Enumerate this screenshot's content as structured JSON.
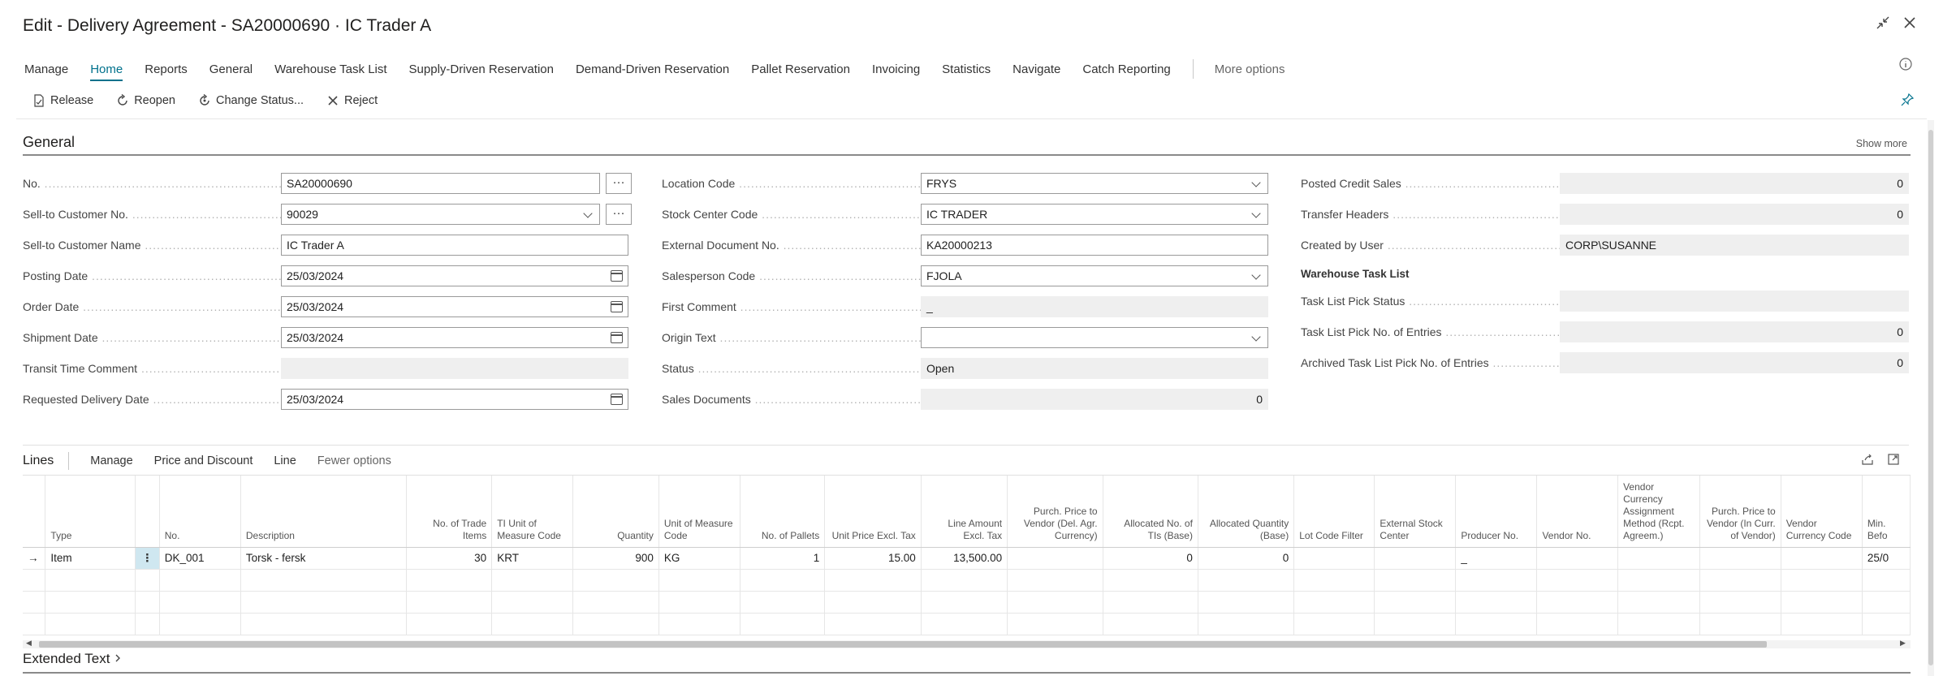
{
  "window": {
    "title": "Edit - Delivery Agreement - SA20000690 · IC Trader A",
    "collapse_icon": "collapse-icon",
    "close_icon": "close-icon",
    "info_icon": "info-icon",
    "pin_icon": "pin-icon"
  },
  "tabs": [
    {
      "label": "Manage"
    },
    {
      "label": "Home",
      "active": true
    },
    {
      "label": "Reports"
    },
    {
      "label": "General"
    },
    {
      "label": "Warehouse Task List"
    },
    {
      "label": "Supply-Driven Reservation"
    },
    {
      "label": "Demand-Driven Reservation"
    },
    {
      "label": "Pallet Reservation"
    },
    {
      "label": "Invoicing"
    },
    {
      "label": "Statistics"
    },
    {
      "label": "Navigate"
    },
    {
      "label": "Catch Reporting"
    }
  ],
  "tabs_more": "More options",
  "actions": [
    {
      "label": "Release",
      "icon": "release-icon"
    },
    {
      "label": "Reopen",
      "icon": "reopen-icon"
    },
    {
      "label": "Change Status...",
      "icon": "change-status-icon"
    },
    {
      "label": "Reject",
      "icon": "reject-icon"
    }
  ],
  "general": {
    "title": "General",
    "show_more": "Show more",
    "col1": [
      {
        "label": "No.",
        "value": "SA20000690"
      },
      {
        "label": "Sell-to Customer No.",
        "value": "90029"
      },
      {
        "label": "Sell-to Customer Name",
        "value": "IC Trader A"
      },
      {
        "label": "Posting Date",
        "value": "25/03/2024"
      },
      {
        "label": "Order Date",
        "value": "25/03/2024"
      },
      {
        "label": "Shipment Date",
        "value": "25/03/2024"
      },
      {
        "label": "Transit Time Comment",
        "value": ""
      },
      {
        "label": "Requested Delivery Date",
        "value": "25/03/2024"
      }
    ],
    "col2": [
      {
        "label": "Location Code",
        "value": "FRYS"
      },
      {
        "label": "Stock Center Code",
        "value": "IC TRADER"
      },
      {
        "label": "External Document No.",
        "value": "KA20000213"
      },
      {
        "label": "Salesperson Code",
        "value": "FJOLA"
      },
      {
        "label": "First Comment",
        "value": "_"
      },
      {
        "label": "Origin Text",
        "value": ""
      },
      {
        "label": "Status",
        "value": "Open"
      },
      {
        "label": "Sales Documents",
        "value": "0"
      }
    ],
    "col3": [
      {
        "label": "Posted Credit Sales",
        "value": "0"
      },
      {
        "label": "Transfer Headers",
        "value": "0"
      },
      {
        "label": "Created by User",
        "value": "CORP\\SUSANNE"
      }
    ],
    "warehouse_header": "Warehouse Task List",
    "col3b": [
      {
        "label": "Task List Pick Status",
        "value": ""
      },
      {
        "label": "Task List Pick No. of Entries",
        "value": "0"
      },
      {
        "label": "Archived Task List Pick No. of Entries",
        "value": "0"
      }
    ]
  },
  "lines": {
    "title": "Lines",
    "menu": [
      "Manage",
      "Price and Discount",
      "Line"
    ],
    "fewer": "Fewer options",
    "share_icon": "share-icon",
    "expand_icon": "expand-icon",
    "headers": [
      "Type",
      "No.",
      "Description",
      "No. of Trade Items",
      "TI Unit of Measure Code",
      "Quantity",
      "Unit of Measure Code",
      "No. of Pallets",
      "Unit Price Excl. Tax",
      "Line Amount Excl. Tax",
      "Purch. Price to Vendor (Del. Agr. Currency)",
      "Allocated No. of TIs (Base)",
      "Allocated Quantity (Base)",
      "Lot Code Filter",
      "External Stock Center",
      "Producer No.",
      "Vendor No.",
      "Vendor Currency Assignment Method (Rcpt. Agreem.)",
      "Purch. Price to Vendor (In Curr. of Vendor)",
      "Vendor Currency Code",
      "Min. Befo"
    ],
    "row": {
      "arrow": "→",
      "dots": "⋮",
      "type": "Item",
      "no": "DK_001",
      "description": "Torsk - fersk",
      "trade_items": "30",
      "ti_uom": "KRT",
      "quantity": "900",
      "uom": "KG",
      "pallets": "1",
      "unit_price": "15.00",
      "line_amount": "13,500.00",
      "purch_price": "",
      "alloc_tis": "0",
      "alloc_qty": "0",
      "lot_code": "",
      "ext_stock": "",
      "producer": "_",
      "vendor": "",
      "vendor_curr_method": "",
      "purch_price_curr": "",
      "vendor_curr": "",
      "min_before": "25/0"
    }
  },
  "extended_text": "Extended Text"
}
